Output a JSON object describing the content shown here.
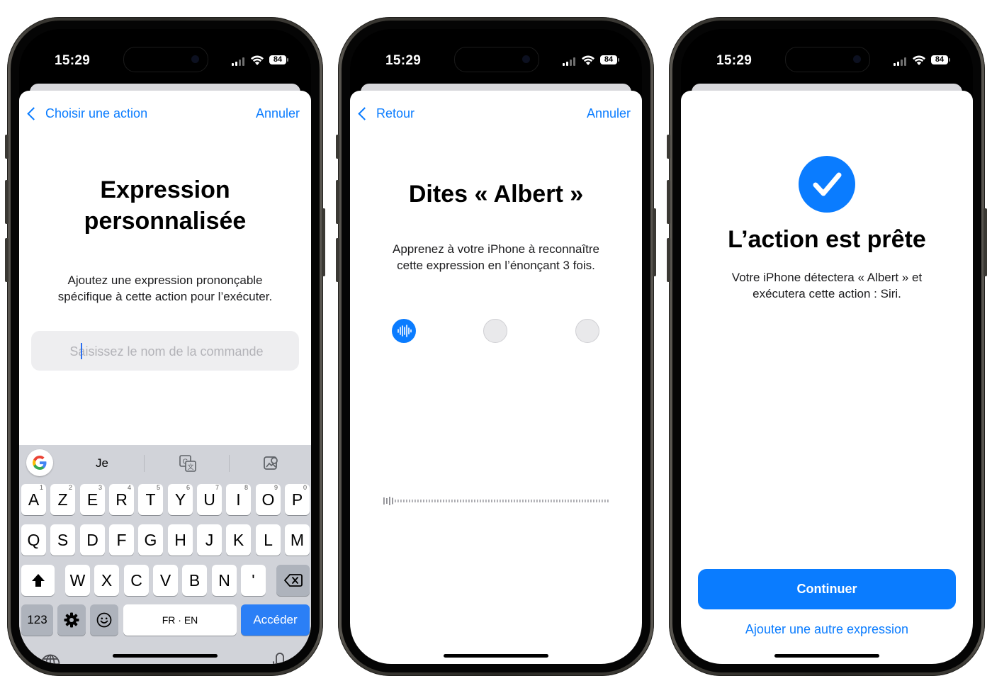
{
  "status_bar": {
    "time": "15:29",
    "battery": "84"
  },
  "screen1": {
    "nav_back": "Choisir une action",
    "nav_cancel": "Annuler",
    "title_line1": "Expression",
    "title_line2": "personnalisée",
    "desc_line1": "Ajoutez une expression prononçable",
    "desc_line2": "spécifique à cette action pour l’exécuter.",
    "input_placeholder": "Saisissez le nom de la commande",
    "input_value": "",
    "keyboard": {
      "suggestion": "Je",
      "row1": [
        "A",
        "Z",
        "E",
        "R",
        "T",
        "Y",
        "U",
        "I",
        "O",
        "P"
      ],
      "row1_numbers": [
        "1",
        "2",
        "3",
        "4",
        "5",
        "6",
        "7",
        "8",
        "9",
        "0"
      ],
      "row2": [
        "Q",
        "S",
        "D",
        "F",
        "G",
        "H",
        "J",
        "K",
        "L",
        "M"
      ],
      "row3": [
        "W",
        "X",
        "C",
        "V",
        "B",
        "N",
        "'"
      ],
      "numbers_key": "123",
      "space_label": "FR · EN",
      "return_label": "Accéder"
    }
  },
  "screen2": {
    "nav_back": "Retour",
    "nav_cancel": "Annuler",
    "title": "Dites « Albert »",
    "desc_line1": "Apprenez à votre iPhone à reconnaître",
    "desc_line2": "cette expression en l’énonçant 3 fois.",
    "steps_total": 3,
    "steps_active": 1
  },
  "screen3": {
    "title": "L’action est prête",
    "desc_line1": "Votre iPhone détectera « Albert » et",
    "desc_line2": "exécutera cette action : Siri.",
    "primary_button": "Continuer",
    "secondary_link": "Ajouter une autre expression"
  },
  "colors": {
    "accent": "#0a7cff",
    "keyboard_bg": "#d1d3d9",
    "return_key": "#2b7ff6",
    "field_bg": "#eeeef0"
  }
}
